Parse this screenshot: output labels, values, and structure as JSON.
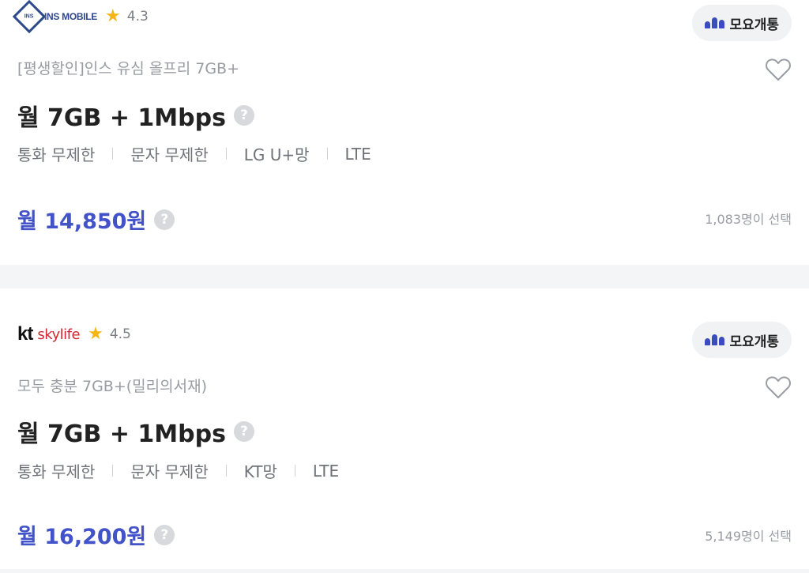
{
  "cards": [
    {
      "carrier": {
        "brand": "INS MOBILE",
        "mark": "INS",
        "rating": "4.3"
      },
      "mvno_label": "모요개통",
      "plan_name": "[평생할인]인스 유심 올프리 7GB+",
      "spec": "월 7GB + 1Mbps",
      "features": [
        "통화 무제한",
        "문자 무제한",
        "LG U+망",
        "LTE"
      ],
      "price": "월 14,850원",
      "selected_count": "1,083명이 선택"
    },
    {
      "carrier": {
        "brand_kt": "kt",
        "brand_sky": "skylife",
        "rating": "4.5"
      },
      "mvno_label": "모요개통",
      "plan_name": "모두 충분 7GB+(밀리의서재)",
      "spec": "월 7GB + 1Mbps",
      "features": [
        "통화 무제한",
        "문자 무제한",
        "KT망",
        "LTE"
      ],
      "price": "월 16,200원",
      "selected_count": "5,149명이 선택"
    }
  ],
  "icons": {
    "star": "star-icon",
    "heart": "heart-icon",
    "help": "question-icon",
    "mvno": "moyo-logo-icon"
  },
  "colors": {
    "accent": "#4252c9",
    "star": "#f4b515",
    "kt_red": "#d3262e"
  }
}
